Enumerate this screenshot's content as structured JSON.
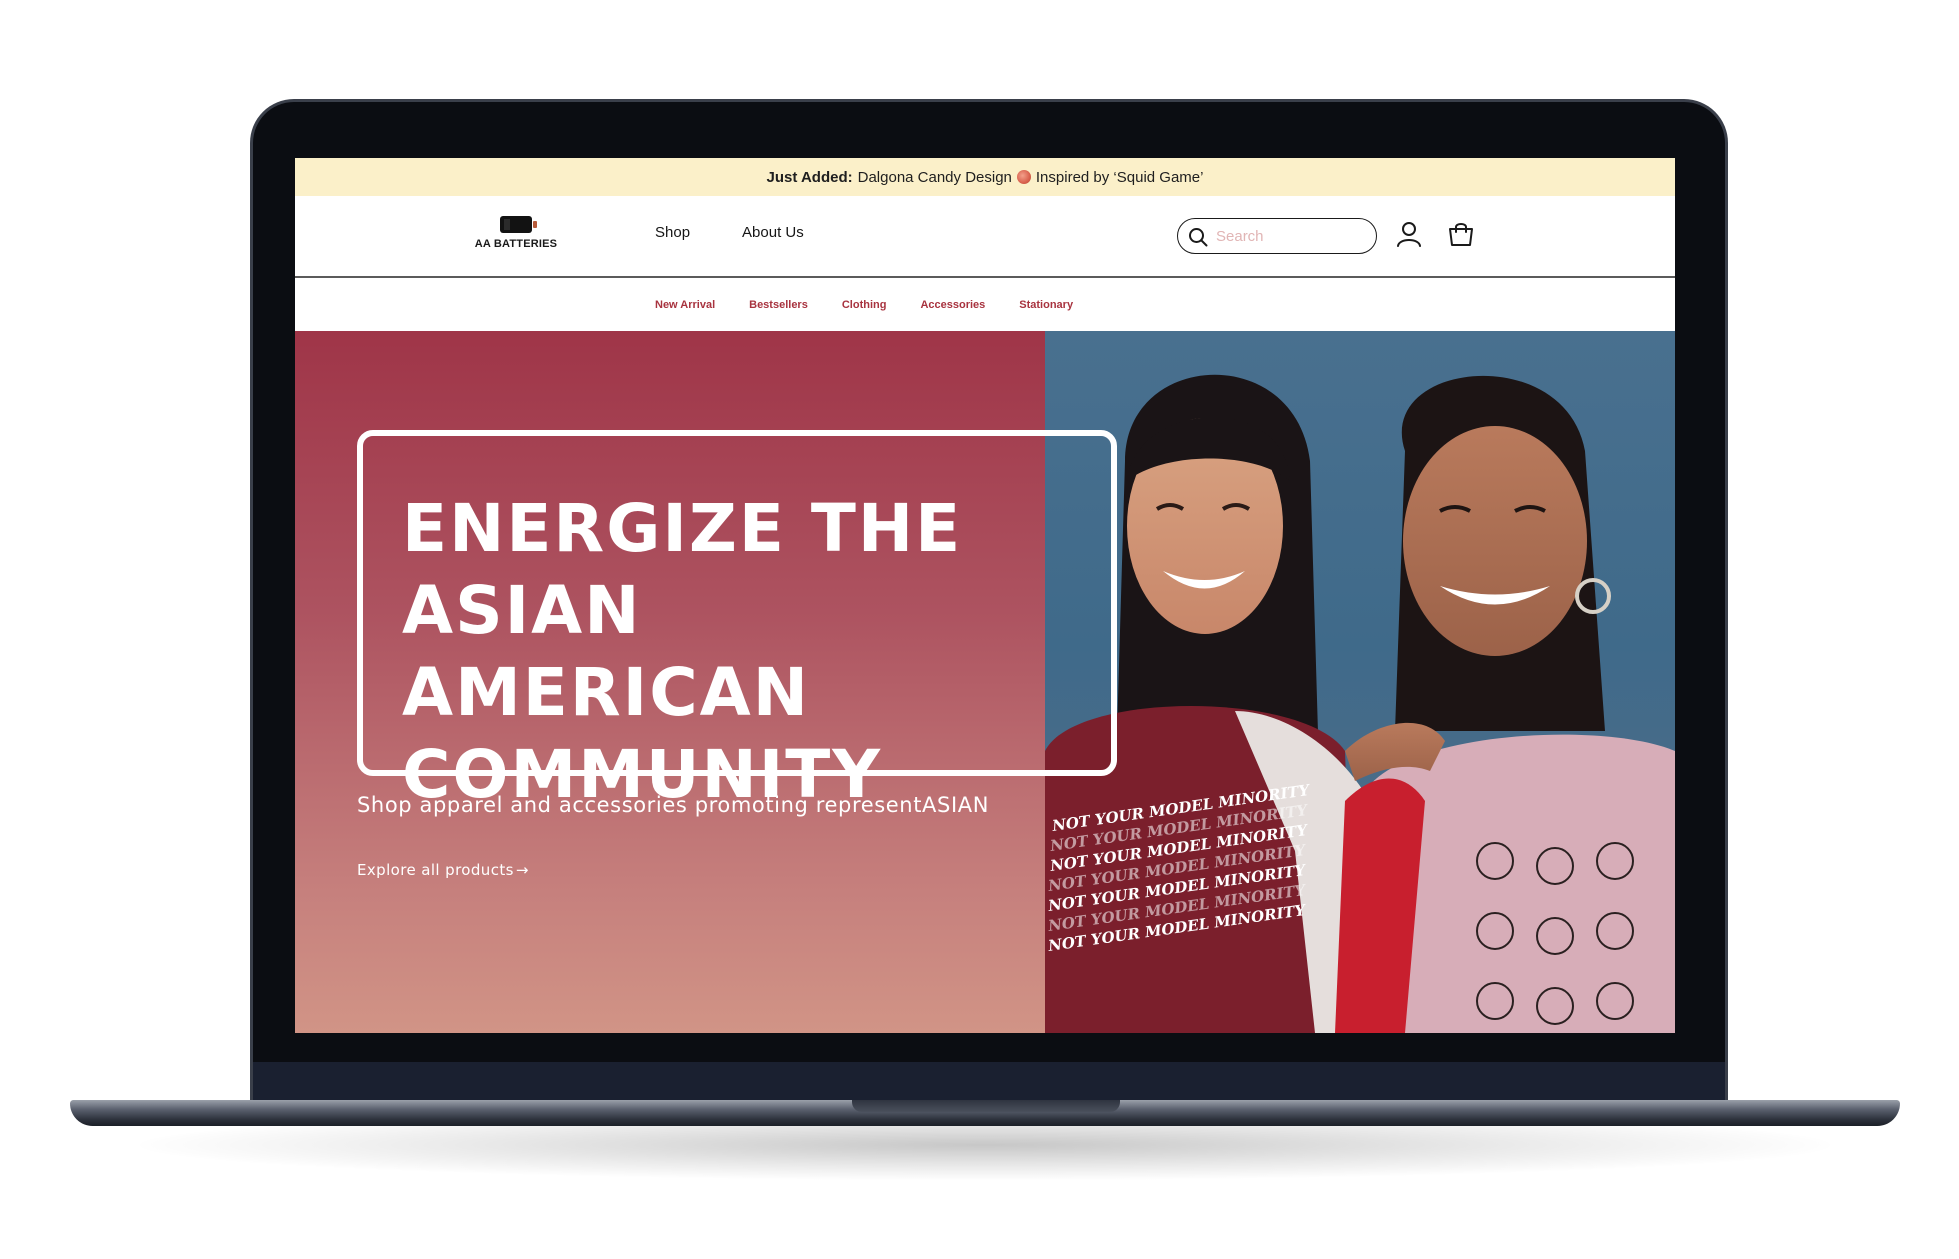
{
  "announcement": {
    "bold": "Just Added:",
    "text_before": "Dalgona Candy Design",
    "text_after": "Inspired by ‘Squid Game’",
    "icon": "candy-icon"
  },
  "brand": {
    "name": "AA BATTERIES",
    "icon": "battery-icon"
  },
  "nav": {
    "items": [
      "Shop",
      "About Us"
    ]
  },
  "search": {
    "placeholder": "Search",
    "value": ""
  },
  "header_icons": [
    "search-icon",
    "account-icon",
    "shopping-bag-icon"
  ],
  "subnav": {
    "items": [
      "New Arrival",
      "Bestsellers",
      "Clothing",
      "Accessories",
      "Stationary"
    ]
  },
  "hero": {
    "title": "ENERGIZE THE\nASIAN AMERICAN\nCOMMUNITY",
    "subtitle": "Shop apparel and accessories promoting representASIAN",
    "link": "Explore all products",
    "link_arrow": "→",
    "shirt_text": "NOT YOUR MODEL MINORITY"
  },
  "colors": {
    "announcement_bg": "#fbf0c9",
    "accent": "#a8333f",
    "hero_top": "#9f3548",
    "hero_bottom": "#d19486"
  }
}
